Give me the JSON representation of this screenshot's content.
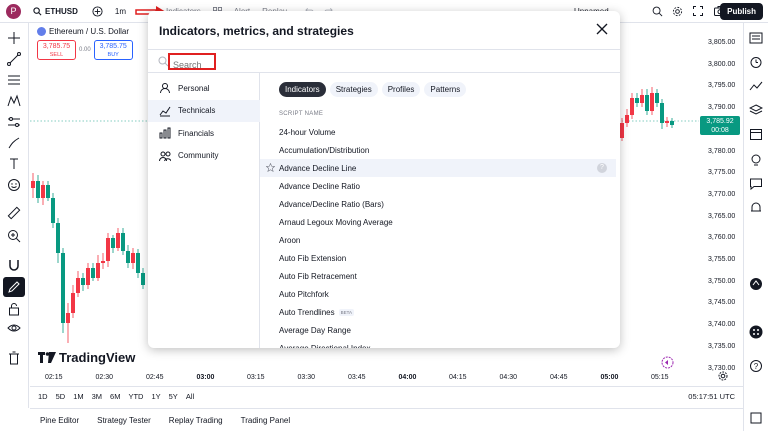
{
  "topbar": {
    "avatar_letter": "P",
    "symbol": "ETHUSD",
    "interval": "1m",
    "indicators_label": "Indicators",
    "alert_label": "Alert",
    "replay_label": "Replay",
    "layout_label": "Unnamed",
    "publish_label": "Publish"
  },
  "ticker": {
    "name": "Ethereum / U.S. Dollar",
    "sell_price": "3,785.75",
    "sell_label": "SELL",
    "spread": "0.00",
    "buy_price": "3,785.75",
    "buy_label": "BUY"
  },
  "price_axis": [
    "3,805.00",
    "3,800.00",
    "3,795.00",
    "3,790.00",
    "3,785.00",
    "3,780.00",
    "3,775.00",
    "3,770.00",
    "3,765.00",
    "3,760.00",
    "3,755.00",
    "3,750.00",
    "3,745.00",
    "3,740.00",
    "3,735.00",
    "3,730.00"
  ],
  "current_price": {
    "price": "3,785.92",
    "time": "00:08"
  },
  "time_axis": [
    "02:15",
    "02:30",
    "02:45",
    "03:00",
    "03:15",
    "03:30",
    "03:45",
    "04:00",
    "04:15",
    "04:30",
    "04:45",
    "05:00",
    "05:15"
  ],
  "time_axis_bold": [
    "03:00",
    "04:00",
    "05:00"
  ],
  "logo_text": "TradingView",
  "ranges": [
    "1D",
    "5D",
    "1M",
    "3M",
    "6M",
    "YTD",
    "1Y",
    "5Y",
    "All"
  ],
  "clock": "05:17:51 UTC",
  "bottom_tabs": [
    "Pine Editor",
    "Strategy Tester",
    "Replay Trading",
    "Trading Panel"
  ],
  "dialog": {
    "title": "Indicators, metrics, and strategies",
    "search_placeholder": "Search",
    "side_items": [
      {
        "label": "Personal",
        "icon": "person-icon"
      },
      {
        "label": "Technicals",
        "icon": "chart-icon"
      },
      {
        "label": "Financials",
        "icon": "financials-icon"
      },
      {
        "label": "Community",
        "icon": "community-icon"
      }
    ],
    "active_side": "Technicals",
    "pills": [
      "Indicators",
      "Strategies",
      "Profiles",
      "Patterns"
    ],
    "active_pill": "Indicators",
    "column_header": "SCRIPT NAME",
    "items": [
      "24-hour Volume",
      "Accumulation/Distribution",
      "Advance Decline Line",
      "Advance Decline Ratio",
      "Advance/Decline Ratio (Bars)",
      "Arnaud Legoux Moving Average",
      "Aroon",
      "Auto Fib Extension",
      "Auto Fib Retracement",
      "Auto Pitchfork",
      "Auto Trendlines",
      "Average Day Range",
      "Average Directional Index"
    ],
    "hovered_item": "Advance Decline Line",
    "beta_item": "Auto Trendlines",
    "beta_label": "BETA",
    "help_glyph": "?"
  },
  "colors": {
    "up": "#089981",
    "down": "#f23645",
    "accent": "#2962ff",
    "annotation": "#e02020"
  }
}
